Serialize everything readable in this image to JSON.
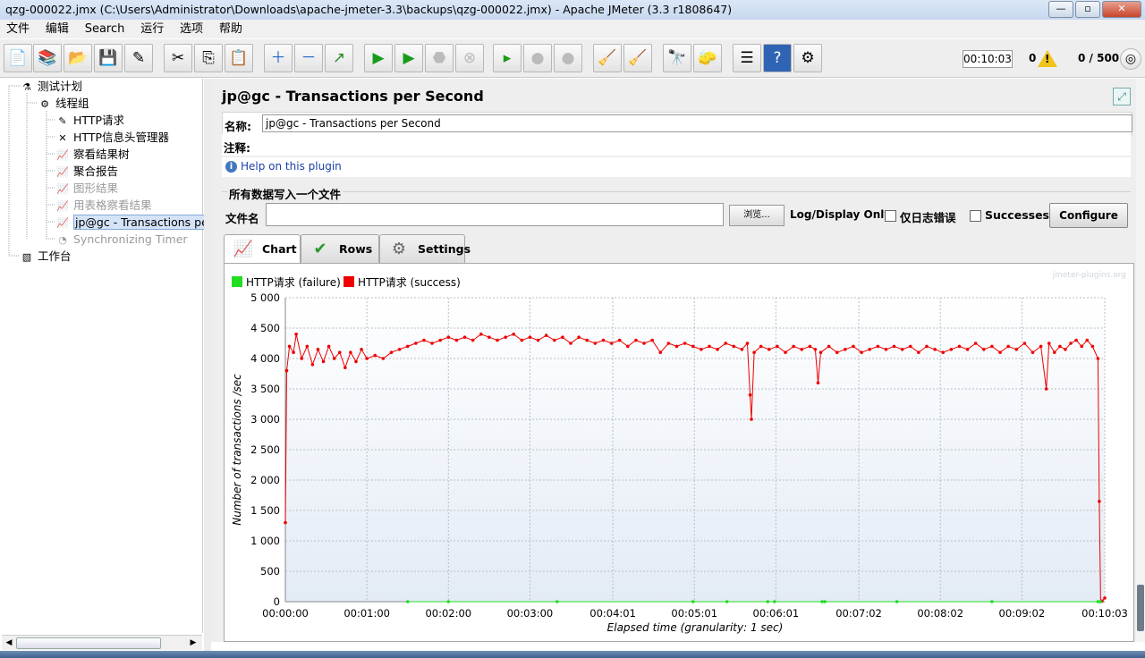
{
  "window": {
    "title": "qzg-000022.jmx (C:\\Users\\Administrator\\Downloads\\apache-jmeter-3.3\\backups\\qzg-000022.jmx) - Apache JMeter (3.3 r1808647)",
    "buttons": [
      "—",
      "▫",
      "✕"
    ]
  },
  "menu": [
    "文件",
    "编辑",
    "Search",
    "运行",
    "选项",
    "帮助"
  ],
  "toolbar": {
    "timer": "00:10:03",
    "warnings": "0",
    "threads": "0 / 500"
  },
  "tree": {
    "items": [
      {
        "label": "测试计划",
        "icon": "test-plan-icon"
      },
      {
        "label": "线程组",
        "icon": "thread-group-icon"
      },
      {
        "label": "HTTP请求",
        "icon": "sampler-icon"
      },
      {
        "label": "HTTP信息头管理器",
        "icon": "config-icon"
      },
      {
        "label": "察看结果树",
        "icon": "listener-icon"
      },
      {
        "label": "聚合报告",
        "icon": "listener-icon"
      },
      {
        "label": "图形结果",
        "icon": "listener-icon"
      },
      {
        "label": "用表格察看结果",
        "icon": "listener-icon"
      },
      {
        "label": "jp@gc - Transactions per",
        "icon": "listener-icon"
      },
      {
        "label": "Synchronizing Timer",
        "icon": "timer-icon"
      },
      {
        "label": "工作台",
        "icon": "workbench-icon"
      }
    ]
  },
  "panel": {
    "title": "jp@gc - Transactions per Second",
    "name_label": "名称:",
    "name_value": "jp@gc - Transactions per Second",
    "comment_label": "注释:",
    "help_link": "Help on this plugin",
    "file_group_label": "所有数据写入一个文件",
    "file_label": "文件名",
    "browse_label": "浏览...",
    "log_display_label": "Log/Display Only:",
    "errors_only_label": "仅日志错误",
    "successes_label": "Successes",
    "configure_label": "Configure"
  },
  "tabs": [
    {
      "label": "Chart",
      "active": true
    },
    {
      "label": "Rows",
      "active": false
    },
    {
      "label": "Settings",
      "active": false
    }
  ],
  "chart_data": {
    "type": "line",
    "watermark": "jmeter-plugins.org",
    "xlabel": "Elapsed time (granularity: 1 sec)",
    "ylabel": "Number of transactions /sec",
    "xlim": [
      0,
      603
    ],
    "ylim": [
      0,
      5000
    ],
    "x_ticks": [
      {
        "t": 0,
        "label": "00:00:00"
      },
      {
        "t": 60,
        "label": "00:01:00"
      },
      {
        "t": 120,
        "label": "00:02:00"
      },
      {
        "t": 180,
        "label": "00:03:00"
      },
      {
        "t": 241,
        "label": "00:04:01"
      },
      {
        "t": 301,
        "label": "00:05:01"
      },
      {
        "t": 361,
        "label": "00:06:01"
      },
      {
        "t": 422,
        "label": "00:07:02"
      },
      {
        "t": 482,
        "label": "00:08:02"
      },
      {
        "t": 542,
        "label": "00:09:02"
      },
      {
        "t": 603,
        "label": "00:10:03"
      }
    ],
    "y_ticks": [
      "0",
      "500",
      "1 000",
      "1 500",
      "2 000",
      "2 500",
      "3 000",
      "3 500",
      "4 000",
      "4 500",
      "5 000"
    ],
    "legend": [
      {
        "name": "HTTP请求 (failure)",
        "color": "#22dd22"
      },
      {
        "name": "HTTP请求 (success)",
        "color": "#ee0000"
      }
    ],
    "series": [
      {
        "name": "HTTP请求 (success)",
        "color": "#ee0000",
        "points": [
          [
            0,
            1300
          ],
          [
            1,
            3800
          ],
          [
            3,
            4200
          ],
          [
            6,
            4100
          ],
          [
            8,
            4400
          ],
          [
            12,
            4000
          ],
          [
            16,
            4200
          ],
          [
            20,
            3900
          ],
          [
            24,
            4150
          ],
          [
            28,
            3950
          ],
          [
            32,
            4200
          ],
          [
            36,
            4000
          ],
          [
            40,
            4100
          ],
          [
            44,
            3850
          ],
          [
            48,
            4100
          ],
          [
            52,
            3950
          ],
          [
            56,
            4150
          ],
          [
            60,
            4000
          ],
          [
            66,
            4050
          ],
          [
            72,
            4000
          ],
          [
            78,
            4100
          ],
          [
            84,
            4150
          ],
          [
            90,
            4200
          ],
          [
            96,
            4250
          ],
          [
            102,
            4300
          ],
          [
            108,
            4250
          ],
          [
            114,
            4300
          ],
          [
            120,
            4350
          ],
          [
            126,
            4300
          ],
          [
            132,
            4350
          ],
          [
            138,
            4300
          ],
          [
            144,
            4400
          ],
          [
            150,
            4350
          ],
          [
            156,
            4300
          ],
          [
            162,
            4350
          ],
          [
            168,
            4400
          ],
          [
            174,
            4300
          ],
          [
            180,
            4350
          ],
          [
            186,
            4300
          ],
          [
            192,
            4380
          ],
          [
            198,
            4300
          ],
          [
            204,
            4350
          ],
          [
            210,
            4250
          ],
          [
            216,
            4350
          ],
          [
            222,
            4300
          ],
          [
            228,
            4250
          ],
          [
            234,
            4300
          ],
          [
            240,
            4250
          ],
          [
            246,
            4300
          ],
          [
            252,
            4200
          ],
          [
            258,
            4300
          ],
          [
            264,
            4250
          ],
          [
            270,
            4300
          ],
          [
            276,
            4100
          ],
          [
            282,
            4250
          ],
          [
            288,
            4200
          ],
          [
            294,
            4250
          ],
          [
            300,
            4200
          ],
          [
            306,
            4150
          ],
          [
            312,
            4200
          ],
          [
            318,
            4150
          ],
          [
            324,
            4250
          ],
          [
            330,
            4200
          ],
          [
            336,
            4150
          ],
          [
            340,
            4250
          ],
          [
            342,
            3400
          ],
          [
            343,
            3000
          ],
          [
            345,
            4100
          ],
          [
            350,
            4200
          ],
          [
            356,
            4150
          ],
          [
            362,
            4200
          ],
          [
            368,
            4100
          ],
          [
            374,
            4200
          ],
          [
            380,
            4150
          ],
          [
            386,
            4200
          ],
          [
            390,
            4150
          ],
          [
            392,
            3600
          ],
          [
            394,
            4100
          ],
          [
            400,
            4200
          ],
          [
            406,
            4100
          ],
          [
            412,
            4150
          ],
          [
            418,
            4200
          ],
          [
            424,
            4100
          ],
          [
            430,
            4150
          ],
          [
            436,
            4200
          ],
          [
            442,
            4150
          ],
          [
            448,
            4200
          ],
          [
            454,
            4150
          ],
          [
            460,
            4200
          ],
          [
            466,
            4100
          ],
          [
            472,
            4200
          ],
          [
            478,
            4150
          ],
          [
            484,
            4100
          ],
          [
            490,
            4150
          ],
          [
            496,
            4200
          ],
          [
            502,
            4150
          ],
          [
            508,
            4250
          ],
          [
            514,
            4150
          ],
          [
            520,
            4200
          ],
          [
            526,
            4100
          ],
          [
            532,
            4200
          ],
          [
            538,
            4150
          ],
          [
            544,
            4250
          ],
          [
            550,
            4100
          ],
          [
            556,
            4200
          ],
          [
            560,
            3500
          ],
          [
            562,
            4250
          ],
          [
            566,
            4100
          ],
          [
            570,
            4200
          ],
          [
            574,
            4150
          ],
          [
            578,
            4250
          ],
          [
            582,
            4300
          ],
          [
            586,
            4200
          ],
          [
            590,
            4300
          ],
          [
            594,
            4200
          ],
          [
            598,
            4000
          ],
          [
            599,
            1650
          ],
          [
            600,
            0
          ],
          [
            601,
            10
          ],
          [
            603,
            60
          ]
        ]
      },
      {
        "name": "HTTP请求 (failure)",
        "color": "#22dd22",
        "points": [
          [
            90,
            0
          ],
          [
            120,
            0
          ],
          [
            200,
            0
          ],
          [
            300,
            0
          ],
          [
            325,
            0
          ],
          [
            355,
            0
          ],
          [
            360,
            0
          ],
          [
            395,
            0
          ],
          [
            397,
            0
          ],
          [
            450,
            0
          ],
          [
            520,
            0
          ],
          [
            598,
            0
          ],
          [
            600,
            0
          ]
        ]
      }
    ]
  }
}
